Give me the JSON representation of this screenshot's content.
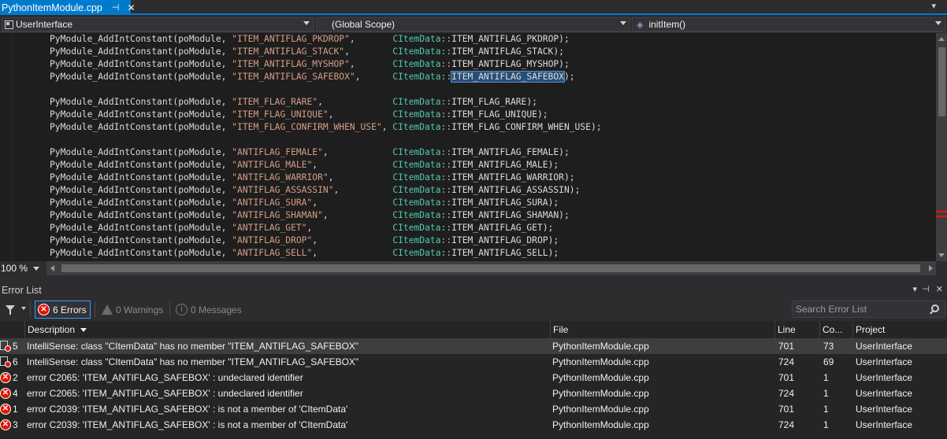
{
  "tab": {
    "title": "PythonItemModule.cpp",
    "pin_glyph": "⊣",
    "close_glyph": "✕"
  },
  "navbar": {
    "project": "UserInterface",
    "scope": "(Global Scope)",
    "member": "initItem()"
  },
  "code_lines": [
    {
      "call": "PyModule_AddIntConstant(poModule, ",
      "str": "\"ITEM_ANTIFLAG_PKDROP\"",
      "pad": ",       ",
      "cls": "CItemData",
      "member": "ITEM_ANTIFLAG_PKDROP",
      "end": ");",
      "selected": false
    },
    {
      "call": "PyModule_AddIntConstant(poModule, ",
      "str": "\"ITEM_ANTIFLAG_STACK\"",
      "pad": ",        ",
      "cls": "CItemData",
      "member": "ITEM_ANTIFLAG_STACK",
      "end": ");",
      "selected": false
    },
    {
      "call": "PyModule_AddIntConstant(poModule, ",
      "str": "\"ITEM_ANTIFLAG_MYSHOP\"",
      "pad": ",       ",
      "cls": "CItemData",
      "member": "ITEM_ANTIFLAG_MYSHOP",
      "end": ");",
      "selected": false
    },
    {
      "call": "PyModule_AddIntConstant(poModule, ",
      "str": "\"ITEM_ANTIFLAG_SAFEBOX\"",
      "pad": ",      ",
      "cls": "CItemData",
      "member": "ITEM_ANTIFLAG_SAFEBOX",
      "end": ");",
      "selected": true
    },
    {
      "blank": true
    },
    {
      "call": "PyModule_AddIntConstant(poModule, ",
      "str": "\"ITEM_FLAG_RARE\"",
      "pad": ",             ",
      "cls": "CItemData",
      "member": "ITEM_FLAG_RARE",
      "end": ");",
      "selected": false
    },
    {
      "call": "PyModule_AddIntConstant(poModule, ",
      "str": "\"ITEM_FLAG_UNIQUE\"",
      "pad": ",           ",
      "cls": "CItemData",
      "member": "ITEM_FLAG_UNIQUE",
      "end": ");",
      "selected": false
    },
    {
      "call": "PyModule_AddIntConstant(poModule, ",
      "str": "\"ITEM_FLAG_CONFIRM_WHEN_USE\"",
      "pad": ", ",
      "cls": "CItemData",
      "member": "ITEM_FLAG_CONFIRM_WHEN_USE",
      "end": ");",
      "selected": false
    },
    {
      "blank": true
    },
    {
      "call": "PyModule_AddIntConstant(poModule, ",
      "str": "\"ANTIFLAG_FEMALE\"",
      "pad": ",            ",
      "cls": "CItemData",
      "member": "ITEM_ANTIFLAG_FEMALE",
      "end": ");",
      "selected": false
    },
    {
      "call": "PyModule_AddIntConstant(poModule, ",
      "str": "\"ANTIFLAG_MALE\"",
      "pad": ",              ",
      "cls": "CItemData",
      "member": "ITEM_ANTIFLAG_MALE",
      "end": ");",
      "selected": false
    },
    {
      "call": "PyModule_AddIntConstant(poModule, ",
      "str": "\"ANTIFLAG_WARRIOR\"",
      "pad": ",           ",
      "cls": "CItemData",
      "member": "ITEM_ANTIFLAG_WARRIOR",
      "end": ");",
      "selected": false
    },
    {
      "call": "PyModule_AddIntConstant(poModule, ",
      "str": "\"ANTIFLAG_ASSASSIN\"",
      "pad": ",          ",
      "cls": "CItemData",
      "member": "ITEM_ANTIFLAG_ASSASSIN",
      "end": ");",
      "selected": false
    },
    {
      "call": "PyModule_AddIntConstant(poModule, ",
      "str": "\"ANTIFLAG_SURA\"",
      "pad": ",              ",
      "cls": "CItemData",
      "member": "ITEM_ANTIFLAG_SURA",
      "end": ");",
      "selected": false
    },
    {
      "call": "PyModule_AddIntConstant(poModule, ",
      "str": "\"ANTIFLAG_SHAMAN\"",
      "pad": ",            ",
      "cls": "CItemData",
      "member": "ITEM_ANTIFLAG_SHAMAN",
      "end": ");",
      "selected": false
    },
    {
      "call": "PyModule_AddIntConstant(poModule, ",
      "str": "\"ANTIFLAG_GET\"",
      "pad": ",               ",
      "cls": "CItemData",
      "member": "ITEM_ANTIFLAG_GET",
      "end": ");",
      "selected": false
    },
    {
      "call": "PyModule_AddIntConstant(poModule, ",
      "str": "\"ANTIFLAG_DROP\"",
      "pad": ",              ",
      "cls": "CItemData",
      "member": "ITEM_ANTIFLAG_DROP",
      "end": ");",
      "selected": false
    },
    {
      "call": "PyModule_AddIntConstant(poModule, ",
      "str": "\"ANTIFLAG_SELL\"",
      "pad": ",              ",
      "cls": "CItemData",
      "member": "ITEM_ANTIFLAG_SELL",
      "end": ");",
      "selected": false
    }
  ],
  "zoom": {
    "level": "100 %"
  },
  "error_list": {
    "title": "Error List",
    "errors_button": "6 Errors",
    "warnings_button": "0 Warnings",
    "messages_button": "0 Messages",
    "search_placeholder": "Search Error List",
    "columns": [
      "Description",
      "File",
      "Line",
      "Co...",
      "Project"
    ],
    "rows": [
      {
        "icon": "intellisense-error-icon",
        "num": "5",
        "description": "IntelliSense: class \"CItemData\" has no member \"ITEM_ANTIFLAG_SAFEBOX\"",
        "file": "PythonItemModule.cpp",
        "line": "701",
        "col": "73",
        "project": "UserInterface"
      },
      {
        "icon": "intellisense-error-icon",
        "num": "6",
        "description": "IntelliSense: class \"CItemData\" has no member \"ITEM_ANTIFLAG_SAFEBOX\"",
        "file": "PythonItemModule.cpp",
        "line": "724",
        "col": "69",
        "project": "UserInterface"
      },
      {
        "icon": "error-icon",
        "num": "2",
        "description": "error C2065: 'ITEM_ANTIFLAG_SAFEBOX' : undeclared identifier",
        "file": "PythonItemModule.cpp",
        "line": "701",
        "col": "1",
        "project": "UserInterface"
      },
      {
        "icon": "error-icon",
        "num": "4",
        "description": "error C2065: 'ITEM_ANTIFLAG_SAFEBOX' : undeclared identifier",
        "file": "PythonItemModule.cpp",
        "line": "724",
        "col": "1",
        "project": "UserInterface"
      },
      {
        "icon": "error-icon",
        "num": "1",
        "description": "error C2039: 'ITEM_ANTIFLAG_SAFEBOX' : is not a member of 'CItemData'",
        "file": "PythonItemModule.cpp",
        "line": "701",
        "col": "1",
        "project": "UserInterface"
      },
      {
        "icon": "error-icon",
        "num": "3",
        "description": "error C2039: 'ITEM_ANTIFLAG_SAFEBOX' : is not a member of 'CItemData'",
        "file": "PythonItemModule.cpp",
        "line": "724",
        "col": "1",
        "project": "UserInterface"
      }
    ]
  },
  "colors": {
    "accent": "#007acc",
    "error": "#e51400",
    "editor_bg": "#1e1e1e",
    "string": "#d69d85",
    "type": "#4ec9b0",
    "selection": "#264f78"
  }
}
